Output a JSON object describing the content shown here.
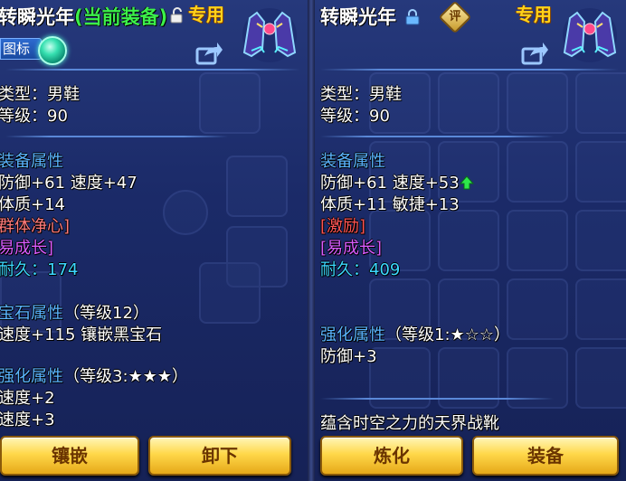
{
  "left": {
    "title": "转瞬光年",
    "title_sub": "(当前装备)",
    "special_tag": "专用",
    "icon_toggle_label": "图标",
    "type_line": "类型：男鞋",
    "level_line": "等级：90",
    "equip_attr_header": "装备属性",
    "attr_line1": "防御+61 速度+47",
    "attr_line2": "体质+14",
    "special_effect": "群体净心]",
    "special_skill": "易成长]",
    "durability_label": "耐久：",
    "durability_value": "174",
    "gem_header": "宝石属性",
    "gem_level": "（等级12）",
    "gem_line": "速度+115 镶嵌黑宝石",
    "enhance_header": "强化属性",
    "enhance_level": "（等级3:★★★）",
    "enhance_line1": "速度+2",
    "enhance_line2": "速度+3",
    "btn_inlay": "镶嵌",
    "btn_unequip": "卸下"
  },
  "right": {
    "title": "转瞬光年",
    "eval_badge": "评",
    "special_tag": "专用",
    "type_line": "类型：男鞋",
    "level_line": "等级：90",
    "equip_attr_header": "装备属性",
    "attr_line1": "防御+61 速度+53",
    "attr_line2": "体质+11 敏捷+13",
    "special_effect": "[激励]",
    "special_skill": "[易成长]",
    "durability_label": "耐久：",
    "durability_value": "409",
    "enhance_header": "强化属性",
    "enhance_level": "（等级1:★☆☆）",
    "enhance_line1": "防御+3",
    "description": "蕴含时空之力的天界战靴",
    "btn_refine": "炼化",
    "btn_equip": "装备"
  },
  "colors": {
    "title_sub": "#3cf04a",
    "special_tag": "#ffd21a",
    "header_blue": "#5ab4ff",
    "effect_red": "#ff5454",
    "skill_purple": "#d85cff",
    "durability_cyan": "#3cd8ff",
    "button_gold": "#ffd84a"
  },
  "icons": [
    "lock-icon",
    "eval-badge-icon",
    "boots-item-icon",
    "share-icon",
    "orb-icon",
    "up-arrow-icon"
  ]
}
